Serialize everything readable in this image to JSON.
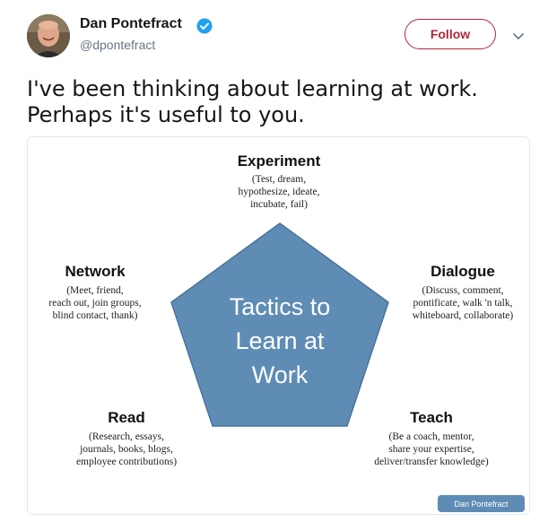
{
  "tweet": {
    "author_name": "Dan Pontefract",
    "author_handle": "@dpontefract",
    "follow_label": "Follow",
    "text": "I've been thinking about learning at work.\nPerhaps it's useful to you."
  },
  "colors": {
    "brand_accent": "#b0263b",
    "verified_blue": "#1da1f2",
    "pentagon_fill": "#5e8cb5",
    "credit_fill": "#5e8cb5"
  },
  "icons": {
    "verified": "verified-badge-icon",
    "menu": "chevron-down-icon"
  },
  "diagram": {
    "center": "Tactics to\nLearn at\nWork",
    "nodes": {
      "experiment": {
        "title": "Experiment",
        "desc": "(Test, dream,\nhypothesize, ideate,\nincubate, fail)"
      },
      "network": {
        "title": "Network",
        "desc": "(Meet, friend,\nreach out, join groups,\nblind contact, thank)"
      },
      "dialogue": {
        "title": "Dialogue",
        "desc": "(Discuss, comment,\npontificate, walk 'n talk,\nwhiteboard, collaborate)"
      },
      "read": {
        "title": "Read",
        "desc": "(Research, essays,\njournals, books, blogs,\nemployee contributions)"
      },
      "teach": {
        "title": "Teach",
        "desc": "(Be a coach, mentor,\nshare your expertise,\ndeliver/transfer knowledge)"
      }
    },
    "credit": "Dan Pontefract"
  }
}
